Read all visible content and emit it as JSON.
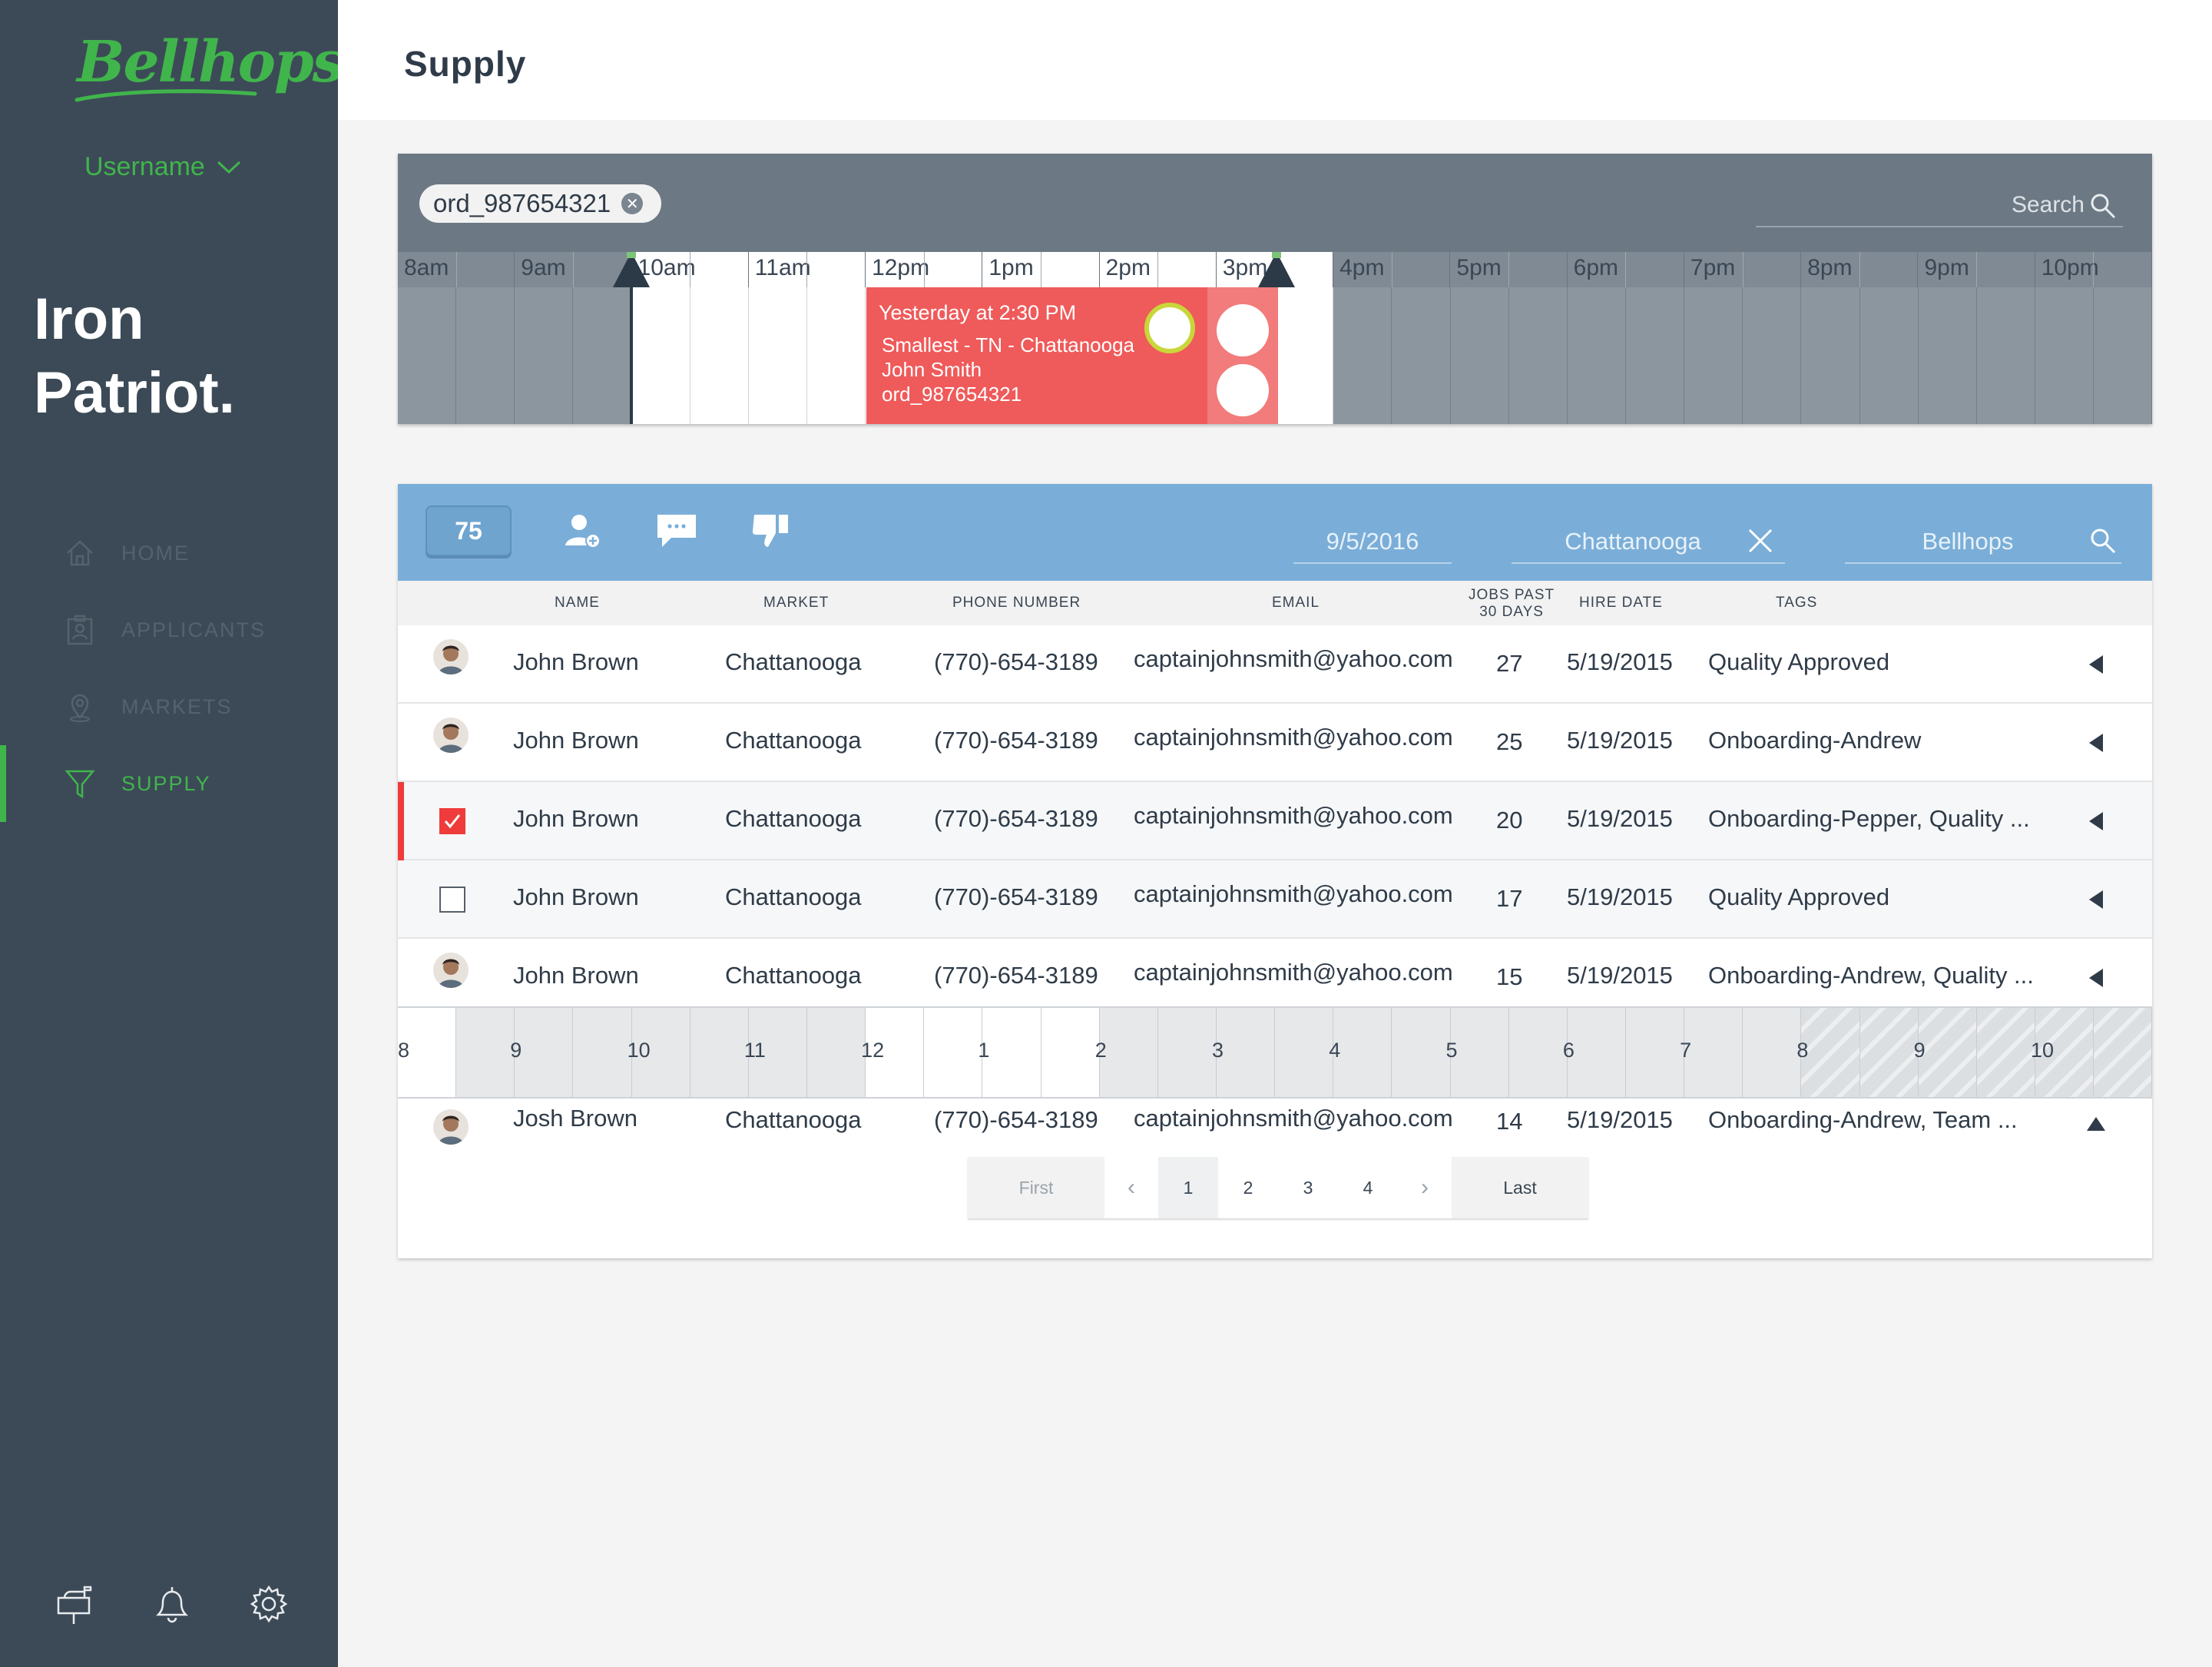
{
  "app": {
    "logo": "Bellhops",
    "user_label": "Username",
    "brand_line1": "Iron",
    "brand_line2": "Patriot."
  },
  "nav": {
    "items": [
      {
        "label": "HOME",
        "icon": "home-icon"
      },
      {
        "label": "APPLICANTS",
        "icon": "applicants-icon"
      },
      {
        "label": "MARKETS",
        "icon": "map-pin-icon"
      },
      {
        "label": "SUPPLY",
        "icon": "funnel-icon",
        "active": true
      }
    ]
  },
  "footer_icons": [
    "mailbox-icon",
    "bell-icon",
    "gear-icon"
  ],
  "header": {
    "title": "Supply"
  },
  "schedule": {
    "order_chip": "ord_987654321",
    "search_placeholder": "Search",
    "hours": [
      "8am",
      "9am",
      "10am",
      "11am",
      "12pm",
      "1pm",
      "2pm",
      "3pm",
      "4pm",
      "5pm",
      "6pm",
      "7pm",
      "8pm",
      "9pm",
      "10pm"
    ],
    "selected_start": "10am",
    "selected_end": "4pm",
    "event": {
      "title": "Yesterday at 2:30 PM",
      "line1": "Smallest - TN - Chattanooga",
      "line2": "John Smith",
      "line3": "ord_987654321"
    }
  },
  "toolbar": {
    "count": "75",
    "date_value": "9/5/2016",
    "market_value": "Chattanooga",
    "company_value": "Bellhops",
    "colors": {
      "bar": "#7aaed8",
      "accent_green": "#40b54b",
      "selected_red": "#ef3b3b"
    }
  },
  "columns": {
    "name": "NAME",
    "market": "MARKET",
    "phone": "PHONE NUMBER",
    "email": "EMAIL",
    "jobs_line1": "JOBS PAST",
    "jobs_line2": "30 DAYS",
    "hire": "HIRE DATE",
    "tags": "TAGS"
  },
  "rows": [
    {
      "name": "John Brown",
      "market": "Chattanooga",
      "phone": "(770)-654-3189",
      "email": "captainjohnsmith@yahoo.com",
      "jobs": "27",
      "hire": "5/19/2015",
      "tags": "Quality Approved",
      "lead": "avatar"
    },
    {
      "name": "John Brown",
      "market": "Chattanooga",
      "phone": "(770)-654-3189",
      "email": "captainjohnsmith@yahoo.com",
      "jobs": "25",
      "hire": "5/19/2015",
      "tags": "Onboarding-Andrew",
      "lead": "avatar"
    },
    {
      "name": "John Brown",
      "market": "Chattanooga",
      "phone": "(770)-654-3189",
      "email": "captainjohnsmith@yahoo.com",
      "jobs": "20",
      "hire": "5/19/2015",
      "tags": "Onboarding-Pepper, Quality ...",
      "lead": "checked"
    },
    {
      "name": "John Brown",
      "market": "Chattanooga",
      "phone": "(770)-654-3189",
      "email": "captainjohnsmith@yahoo.com",
      "jobs": "17",
      "hire": "5/19/2015",
      "tags": "Quality Approved",
      "lead": "unchecked"
    },
    {
      "name": "John Brown",
      "market": "Chattanooga",
      "phone": "(770)-654-3189",
      "email": "captainjohnsmith@yahoo.com",
      "jobs": "15",
      "hire": "5/19/2015",
      "tags": "Onboarding-Andrew, Quality ...",
      "lead": "avatar"
    }
  ],
  "day_strip": {
    "labels": [
      "8",
      "9",
      "10",
      "11",
      "12",
      "1",
      "2",
      "3",
      "4",
      "5",
      "6",
      "7",
      "8",
      "9",
      "10"
    ]
  },
  "expanded_row": {
    "name": "Josh Brown",
    "market": "Chattanooga",
    "phone": "(770)-654-3189",
    "email": "captainjohnsmith@yahoo.com",
    "jobs": "14",
    "hire": "5/19/2015",
    "tags": "Onboarding-Andrew, Team ..."
  },
  "pagination": {
    "first": "First",
    "last": "Last",
    "pages": [
      "1",
      "2",
      "3",
      "4"
    ],
    "current": "1"
  }
}
